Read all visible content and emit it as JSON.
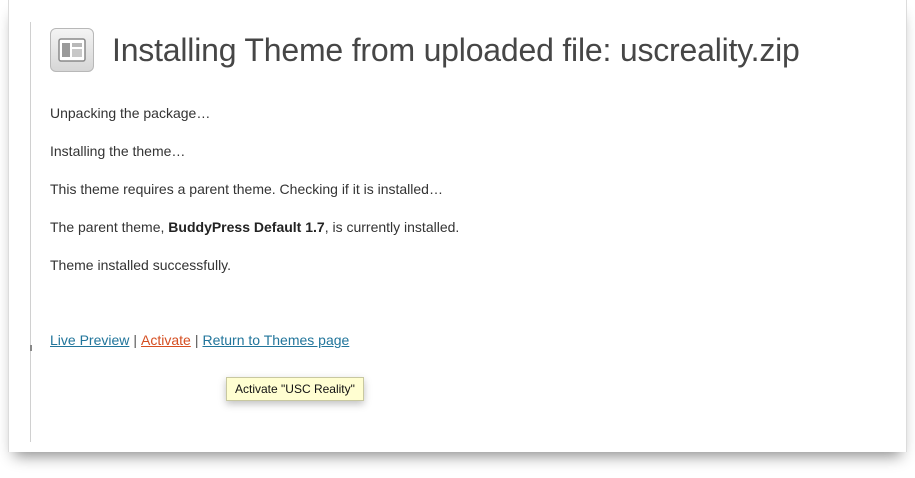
{
  "header": {
    "title": "Installing Theme from uploaded file: uscreality.zip",
    "icon": "theme-appearance-icon"
  },
  "log": {
    "line1": "Unpacking the package…",
    "line2": "Installing the theme…",
    "line3": "This theme requires a parent theme. Checking if it is installed…",
    "line4_prefix": "The parent theme, ",
    "line4_bold": "BuddyPress Default 1.7",
    "line4_suffix": ", is currently installed.",
    "line5": "Theme installed successfully."
  },
  "actions": {
    "live_preview": "Live Preview",
    "activate": "Activate",
    "return": "Return to Themes page",
    "separator": "|"
  },
  "tooltip": {
    "text": "Activate \"USC Reality\""
  },
  "colors": {
    "link": "#21759b",
    "link_hover": "#d54e21",
    "tooltip_bg": "#fffed1"
  }
}
